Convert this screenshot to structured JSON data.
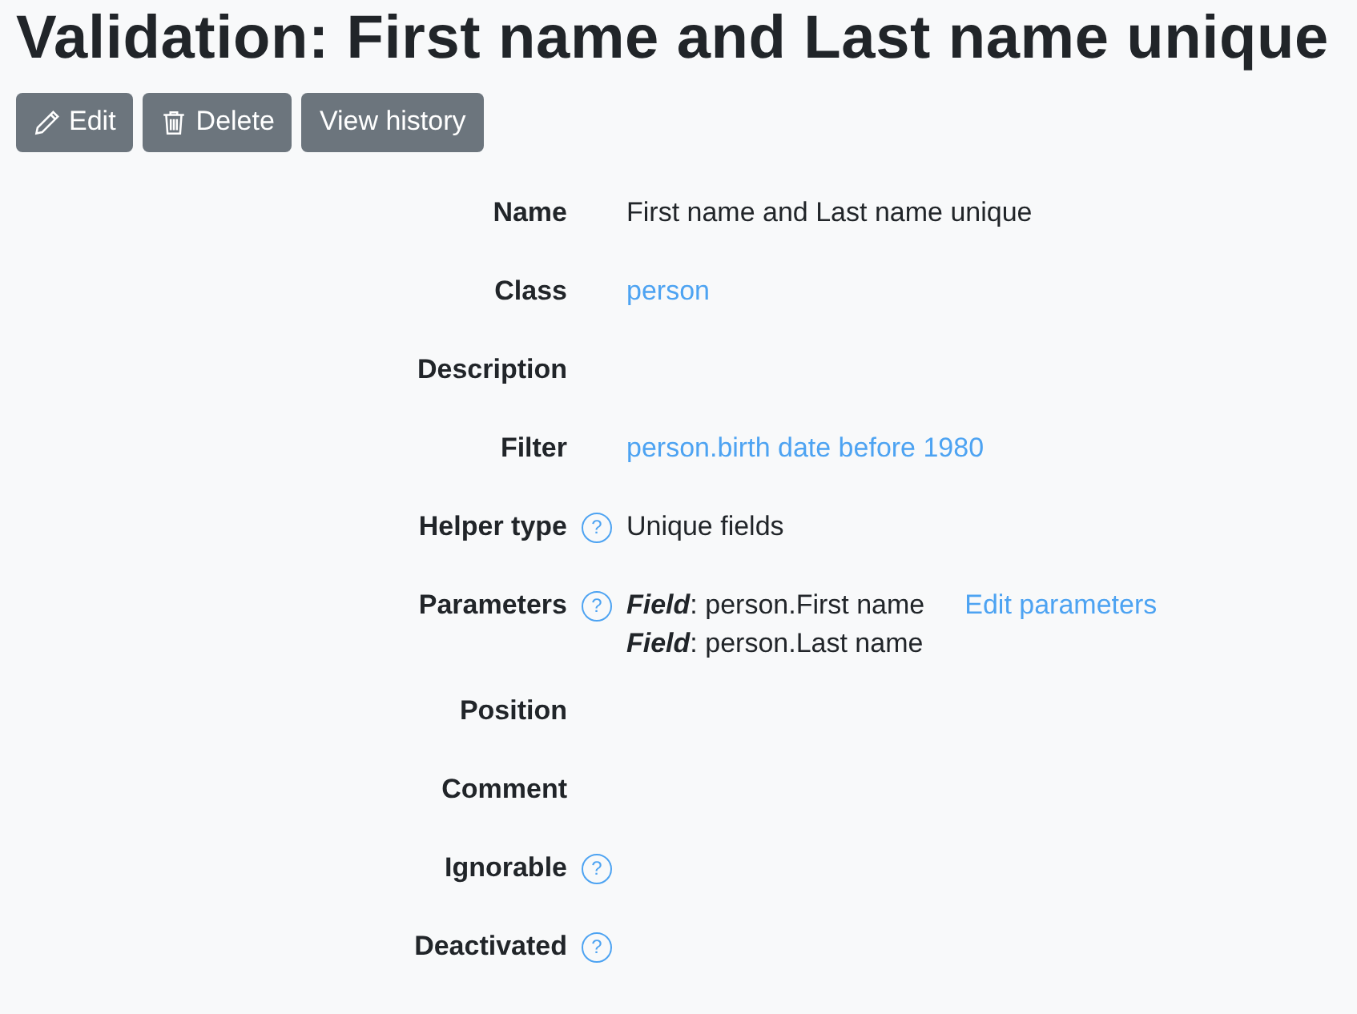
{
  "title": "Validation: First name and Last name unique",
  "buttons": [
    {
      "label": "Edit"
    },
    {
      "label": "Delete"
    },
    {
      "label": "View history"
    }
  ],
  "rows": [
    {
      "label": "Name",
      "kind": "text",
      "value": "First name and Last name unique"
    },
    {
      "label": "Class",
      "kind": "link",
      "value": "person"
    },
    {
      "label": "Description",
      "kind": "empty"
    },
    {
      "label": "Filter",
      "kind": "link",
      "value": "person.birth date before 1980"
    },
    {
      "label": "Helper type",
      "help": "?",
      "kind": "text",
      "value": "Unique fields"
    },
    {
      "label": "Parameters",
      "help": "?",
      "kind": "params",
      "params": [
        "**Field**: person.First name",
        "**Field**: person.Last name"
      ],
      "action": "Edit parameters"
    },
    {
      "label": "Position",
      "kind": "empty"
    },
    {
      "label": "Comment",
      "kind": "empty"
    },
    {
      "label": "Ignorable",
      "help": "?",
      "kind": "empty"
    },
    {
      "label": "Deactivated",
      "help": "?",
      "kind": "empty"
    }
  ]
}
